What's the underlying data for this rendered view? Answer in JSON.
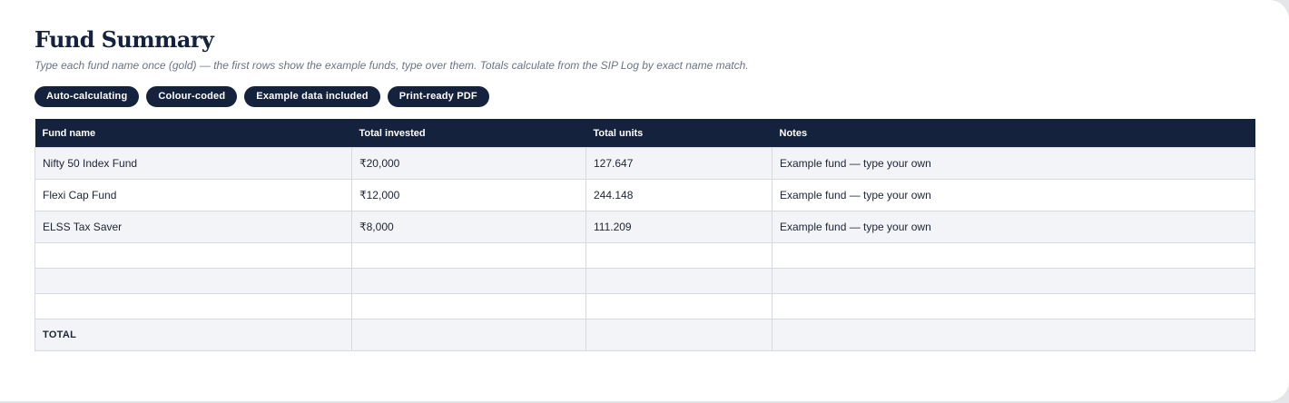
{
  "page": {
    "title": "Fund Summary",
    "subtitle": "Type each fund name once (gold) — the first rows show the example funds, type over them. Totals calculate from the SIP Log by exact name match."
  },
  "badges": [
    {
      "label": "Auto-calculating"
    },
    {
      "label": "Colour-coded"
    },
    {
      "label": "Example data included"
    },
    {
      "label": "Print-ready PDF"
    }
  ],
  "table": {
    "headers": {
      "fund_name": "Fund name",
      "total_invested": "Total invested",
      "total_units": "Total units",
      "notes": "Notes"
    },
    "rows": [
      {
        "fund_name": "Nifty 50 Index Fund",
        "total_invested": "₹20,000",
        "total_units": "127.647",
        "notes": "Example fund — type your own"
      },
      {
        "fund_name": "Flexi Cap Fund",
        "total_invested": "₹12,000",
        "total_units": "244.148",
        "notes": "Example fund — type your own"
      },
      {
        "fund_name": "ELSS Tax Saver",
        "total_invested": "₹8,000",
        "total_units": "111.209",
        "notes": "Example fund — type your own"
      },
      {
        "fund_name": "",
        "total_invested": "",
        "total_units": "",
        "notes": ""
      },
      {
        "fund_name": "",
        "total_invested": "",
        "total_units": "",
        "notes": ""
      },
      {
        "fund_name": "",
        "total_invested": "",
        "total_units": "",
        "notes": ""
      }
    ],
    "total_row": {
      "label": "TOTAL",
      "total_invested": "",
      "total_units": "",
      "notes": ""
    }
  },
  "colors": {
    "header_bg": "#14223d",
    "badge_bg": "#14223d",
    "row_shade": "#f3f4f8",
    "border": "#d6d9df"
  }
}
